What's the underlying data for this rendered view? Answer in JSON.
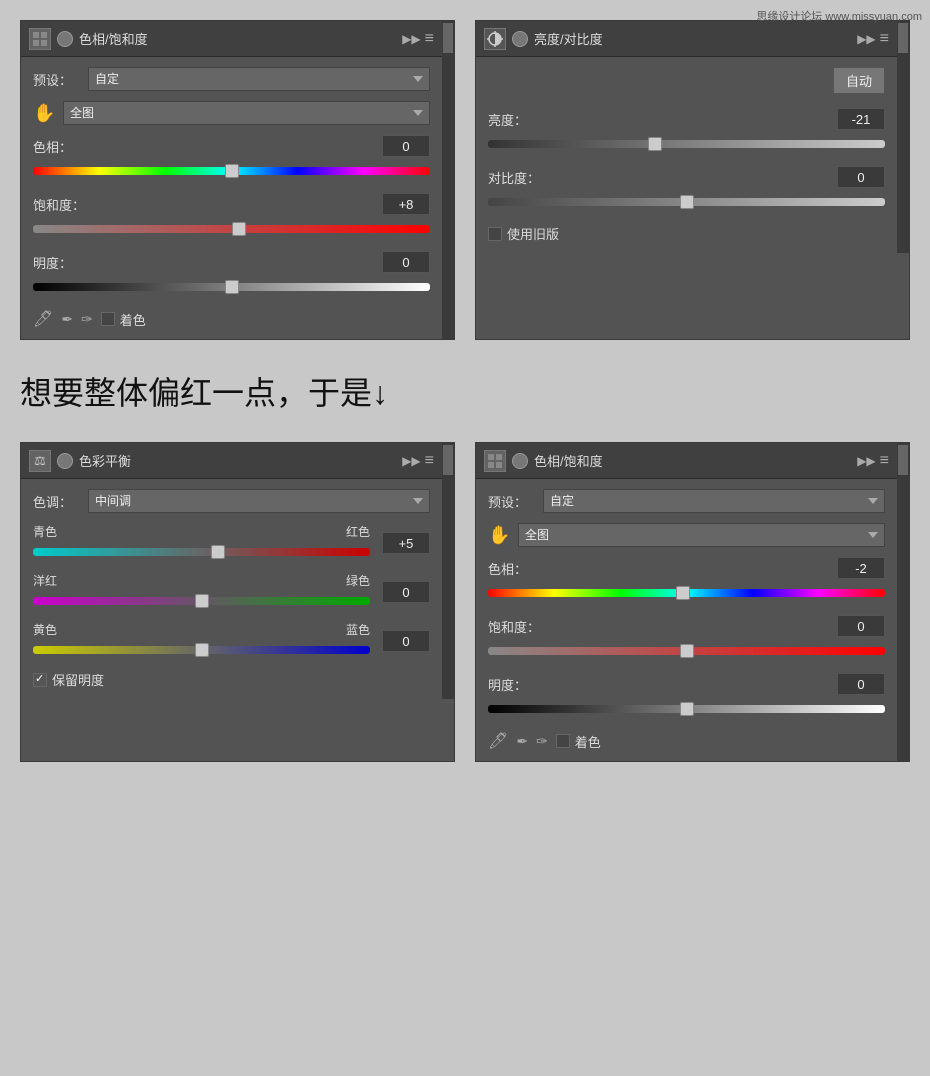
{
  "watermark": "思缘设计论坛 www.missyuan.com",
  "panel_top_left": {
    "title": "色相/饱和度",
    "preset_label": "预设：",
    "preset_value": "自定",
    "channel_value": "全图",
    "hue_label": "色相：",
    "hue_value": "0",
    "hue_thumb_pct": 50,
    "saturation_label": "饱和度：",
    "saturation_value": "+8",
    "saturation_thumb_pct": 52,
    "lightness_label": "明度：",
    "lightness_value": "0",
    "lightness_thumb_pct": 50,
    "colorize_label": "着色"
  },
  "panel_top_right": {
    "title": "亮度/对比度",
    "auto_label": "自动",
    "brightness_label": "亮度：",
    "brightness_value": "-21",
    "brightness_thumb_pct": 42,
    "contrast_label": "对比度：",
    "contrast_value": "0",
    "contrast_thumb_pct": 50,
    "legacy_label": "使用旧版"
  },
  "middle_text": "想要整体偏红一点，于是↓",
  "panel_bottom_left": {
    "title": "色彩平衡",
    "tone_label": "色调：",
    "tone_value": "中间调",
    "cyan_label": "青色",
    "red_label": "红色",
    "cyan_red_value": "+5",
    "cyan_red_thumb_pct": 55,
    "magenta_label": "洋红",
    "green_label": "绿色",
    "magenta_green_value": "0",
    "magenta_green_thumb_pct": 50,
    "yellow_label": "黄色",
    "blue_label": "蓝色",
    "yellow_blue_value": "0",
    "yellow_blue_thumb_pct": 50,
    "preserve_label": "保留明度",
    "preserve_checked": true
  },
  "panel_bottom_right": {
    "title": "色相/饱和度",
    "preset_label": "预设：",
    "preset_value": "自定",
    "channel_value": "全图",
    "hue_label": "色相：",
    "hue_value": "-2",
    "hue_thumb_pct": 49,
    "saturation_label": "饱和度：",
    "saturation_value": "0",
    "saturation_thumb_pct": 50,
    "lightness_label": "明度：",
    "lightness_value": "0",
    "lightness_thumb_pct": 50,
    "colorize_label": "着色"
  },
  "icons": {
    "forward": "▶▶",
    "scroll_down": "▼",
    "hand_tool": "✋",
    "eyedropper": "✏",
    "eyedropper2": "✒",
    "eyedropper3": "✑"
  }
}
